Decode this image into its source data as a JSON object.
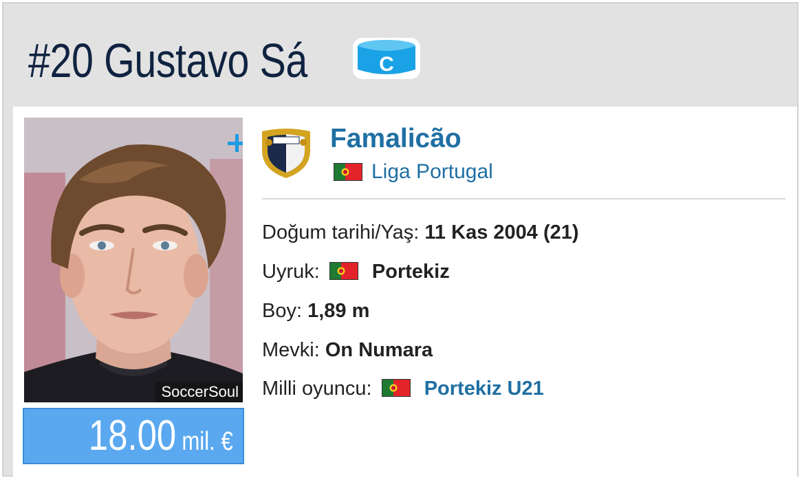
{
  "header": {
    "player_title": "#20 Gustavo Sá",
    "captain_badge_letter": "C"
  },
  "photo": {
    "credit": "SoccerSoul",
    "add_icon": "plus-icon"
  },
  "market_value": {
    "amount": "18.00",
    "unit": "mil. €"
  },
  "club": {
    "name": "Famalicão",
    "league": "Liga Portugal",
    "league_flag": "portugal-flag"
  },
  "details": {
    "birth_label": "Doğum tarihi/Yaş:",
    "birth_value": "11 Kas 2004 (21)",
    "nationality_label": "Uyruk:",
    "nationality_value": "Portekiz",
    "height_label": "Boy:",
    "height_value": "1,89 m",
    "position_label": "Mevki:",
    "position_value": "On Numara",
    "national_label": "Milli oyuncu:",
    "national_value": "Portekiz U21"
  },
  "colors": {
    "title": "#0f2340",
    "link": "#1f6fa3",
    "value_box": "#5aa8ef",
    "plus": "#1d9be2"
  }
}
